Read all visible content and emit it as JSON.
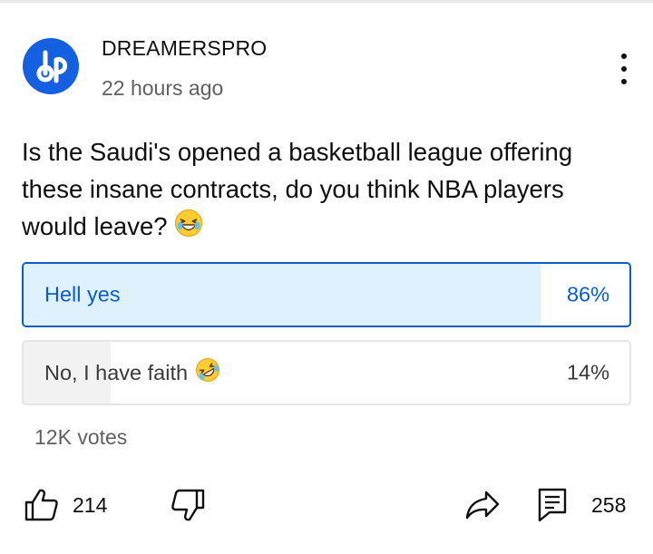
{
  "post": {
    "channel_name": "DREAMERSPRO",
    "avatar_monogram": "dp",
    "timestamp": "22 hours ago",
    "text": "Is the Saudi's opened a basketball league offering these insane contracts, do you think NBA players would leave?",
    "text_emoji": "grinning-squinting-tears-of-joy-face"
  },
  "poll": {
    "options": [
      {
        "label": "Hell yes",
        "percent_label": "86%",
        "percent": 86,
        "selected": true,
        "emoji": null
      },
      {
        "label": "No, I have faith",
        "percent_label": "14%",
        "percent": 14,
        "selected": false,
        "emoji": "rolling-on-floor-laughing-face"
      }
    ],
    "votes": "12K votes"
  },
  "actions": {
    "likes": "214",
    "comments": "258"
  },
  "colors": {
    "avatar_blue": "#1560e0",
    "selected_blue": "#0b5ec7",
    "selected_fill": "#def1fc",
    "unselected_fill": "#f2f2f2",
    "secondary_text": "#606060"
  }
}
